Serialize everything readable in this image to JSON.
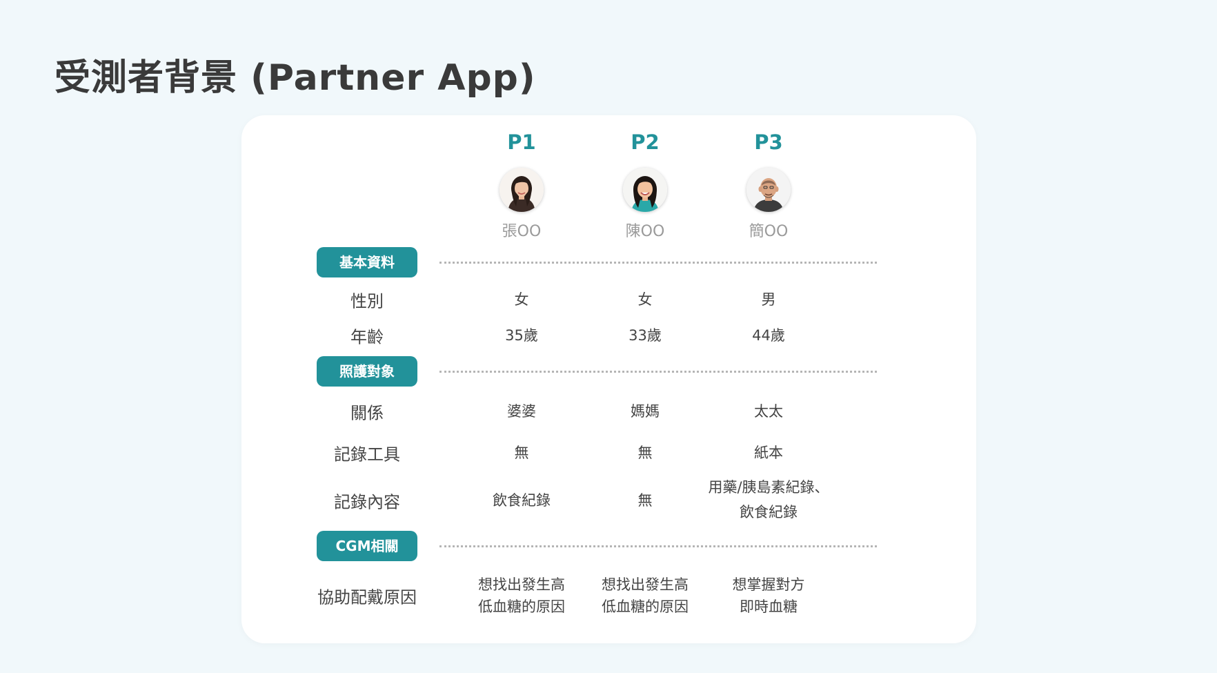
{
  "title": "受測者背景 (Partner App)",
  "participants": [
    {
      "id": "P1",
      "name": "張OO"
    },
    {
      "id": "P2",
      "name": "陳OO"
    },
    {
      "id": "P3",
      "name": "簡OO"
    }
  ],
  "sections": {
    "basic": "基本資料",
    "care": "照護對象",
    "cgm": "CGM相關"
  },
  "rows": {
    "gender": {
      "label": "性別",
      "values": [
        "女",
        "女",
        "男"
      ]
    },
    "age": {
      "label": "年齡",
      "values": [
        "35歲",
        "33歲",
        "44歲"
      ]
    },
    "relation": {
      "label": "關係",
      "values": [
        "婆婆",
        "媽媽",
        "太太"
      ]
    },
    "tool": {
      "label": "記錄工具",
      "values": [
        "無",
        "無",
        "紙本"
      ]
    },
    "content": {
      "label": "記錄內容",
      "values": [
        [
          "飲食紀錄"
        ],
        [
          "無"
        ],
        [
          "用藥/胰島素紀錄、",
          "飲食紀錄"
        ]
      ]
    },
    "reason": {
      "label": "協助配戴原因",
      "values": [
        [
          "想找出發生高",
          "低血糖的原因"
        ],
        [
          "想找出發生高",
          "低血糖的原因"
        ],
        [
          "想掌握對方",
          "即時血糖"
        ]
      ]
    }
  },
  "colors": {
    "accent": "#22929a",
    "background": "#f1f8fb"
  }
}
